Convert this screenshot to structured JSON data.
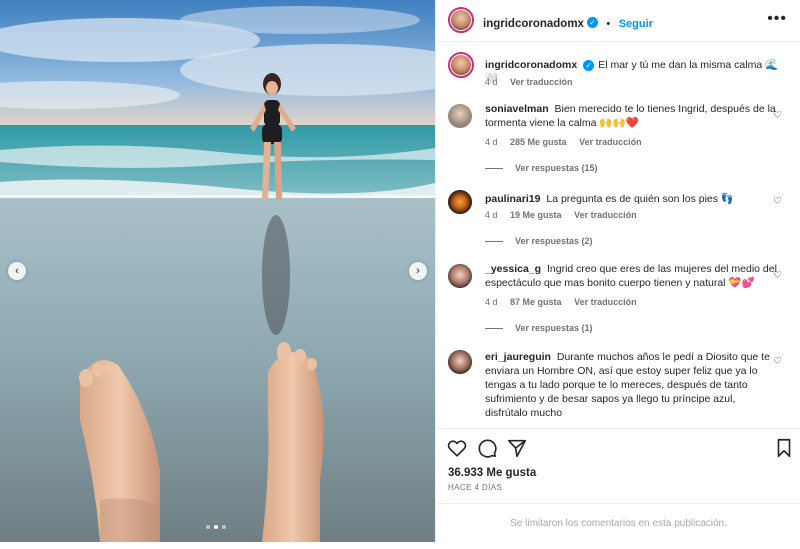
{
  "post": {
    "username": "ingridcoronadomx",
    "follow_label": "Seguir",
    "more_label": "•••",
    "caption_text": "El mar y tú me dan la misma calma 🌊🤍",
    "caption_age": "4 d",
    "caption_translate": "Ver traducción",
    "likes": "36.933 Me gusta",
    "posted_ago": "HACE 4 DÍAS",
    "comments_limited": "Se limitaron los comentarios en esta publicación."
  },
  "carousel": {
    "prev_icon": "‹",
    "next_icon": "›",
    "slide_count": 3,
    "active_slide": 2
  },
  "comments": [
    {
      "user": "soniavelman",
      "text": "Bien merecido te lo tienes Ingrid, después de la tormenta viene la calma 🙌🙌❤️",
      "age": "4 d",
      "likes": "285 Me gusta",
      "translate": "Ver traducción",
      "replies": "Ver respuestas (15)",
      "avatar_color": "#8a9aa8"
    },
    {
      "user": "paulinari19",
      "text": "La pregunta es de quién son los pies 👣",
      "age": "4 d",
      "likes": "19 Me gusta",
      "translate": "Ver traducción",
      "replies": "Ver respuestas (2)",
      "avatar_color": "#3a2a1a"
    },
    {
      "user": "_yessica_g",
      "text": "Ingrid creo que eres de las mujeres del medio del espectáculo que mas bonito cuerpo tienen y natural 💝💕",
      "age": "4 d",
      "likes": "87 Me gusta",
      "translate": "Ver traducción",
      "replies": "Ver respuestas (1)",
      "avatar_color": "#5a4a48"
    },
    {
      "user": "eri_jaureguin",
      "text": "Durante muchos años le pedí a Diosito que te enviara un Hombre ON, así que estoy super feliz que ya lo tengas a tu lado porque te lo mereces, después de tanto sufrimiento y de besar sapos ya llego tu príncipe azul, disfrútalo mucho",
      "avatar_color": "#4a3a38"
    }
  ],
  "colors": {
    "accent": "#0095f6",
    "text": "#262626",
    "muted": "#737373",
    "divider": "#efefef"
  },
  "icons": {
    "verified": "✓",
    "heart": "♡"
  }
}
